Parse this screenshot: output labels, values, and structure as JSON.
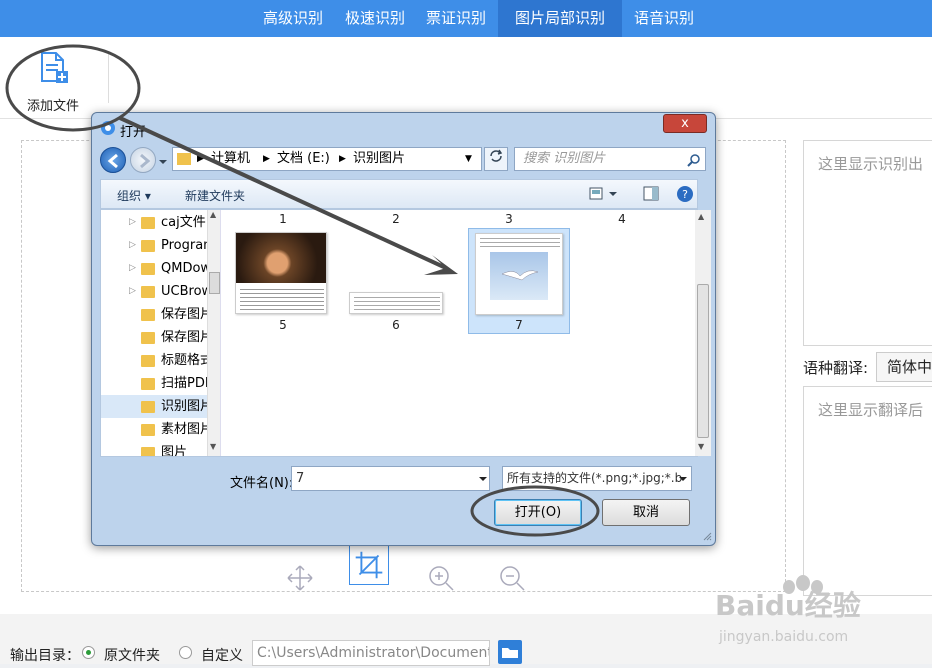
{
  "nav": {
    "tabs": [
      "高级识别",
      "极速识别",
      "票证识别",
      "图片局部识别",
      "语音识别"
    ],
    "active_index": 3
  },
  "toolbar": {
    "add_file_label": "添加文件"
  },
  "right_panel": {
    "result_placeholder": "这里显示识别出",
    "translate_label": "语种翻译:",
    "translate_select": "简体中",
    "translate_placeholder": "这里显示翻译后"
  },
  "footer": {
    "output_label": "输出目录：",
    "opt_original": "原文件夹",
    "opt_custom": "自定义",
    "path": "C:\\Users\\Administrator\\Documents"
  },
  "dialog": {
    "title": "打开",
    "close_label": "x",
    "address": [
      "计算机",
      "文档 (E:)",
      "识别图片"
    ],
    "search_placeholder": "搜索 识别图片",
    "organize": "组织 ▾",
    "new_folder": "新建文件夹",
    "folders": [
      "caj文件",
      "Program",
      "QMDow",
      "UCBrow",
      "保存图片",
      "保存图片",
      "标题格式",
      "扫描PDF",
      "识别图片",
      "素材图片",
      "图片"
    ],
    "selected_folder_index": 8,
    "files_top_row": [
      "1",
      "2",
      "3",
      "4"
    ],
    "files": [
      "5",
      "6",
      "7"
    ],
    "selected_file": "7",
    "filename_label": "文件名(N):",
    "filename_value": "7",
    "filter": "所有支持的文件(*.png;*.jpg;*.b",
    "open_button": "打开(O)",
    "cancel_button": "取消"
  },
  "watermark": {
    "brand": "Baidu经验",
    "url": "jingyan.baidu.com"
  },
  "colors": {
    "nav": "#3e8ee8",
    "nav_active": "#2e76d0",
    "annotation": "#4a4a4a"
  }
}
